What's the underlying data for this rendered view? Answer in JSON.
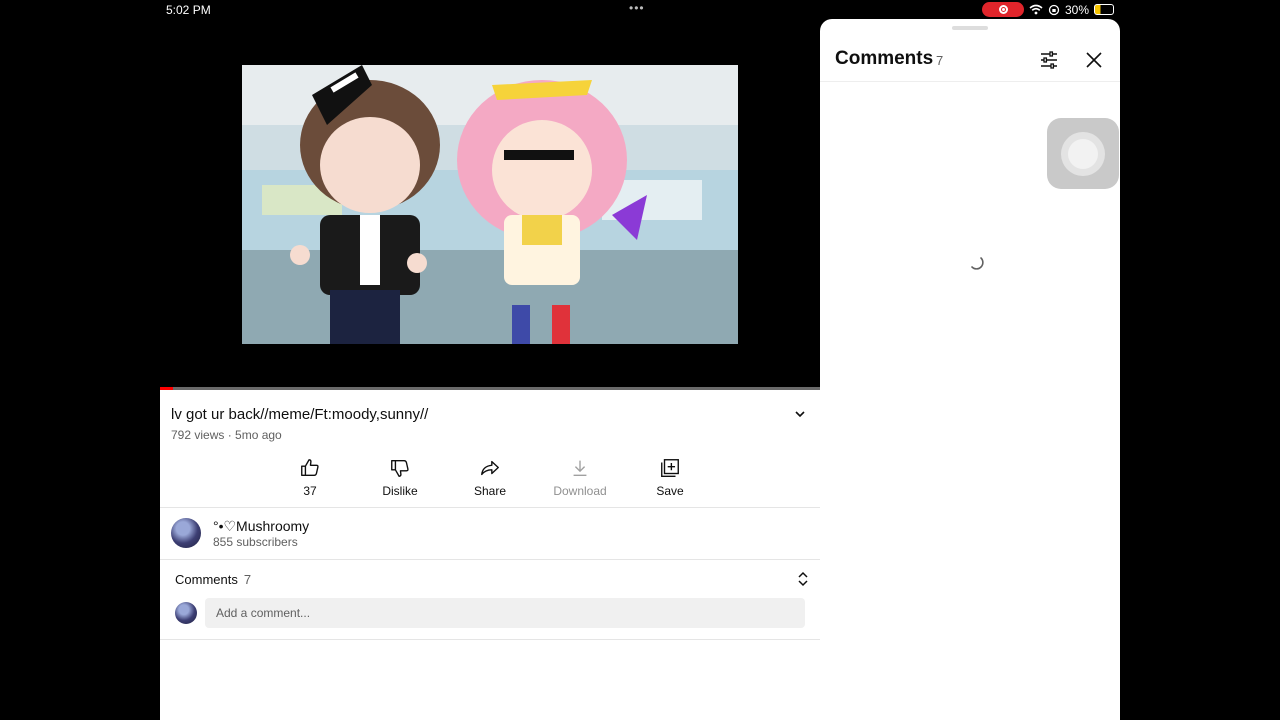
{
  "status_bar": {
    "time": "5:02 PM",
    "battery_percent": "30%",
    "battery_level": 0.3
  },
  "video": {
    "title": "lv got ur back//meme/Ft:moody,sunny//",
    "meta": "792 views · 5mo ago",
    "progress": 0.02
  },
  "actions": {
    "like_count": "37",
    "dislike_label": "Dislike",
    "share_label": "Share",
    "download_label": "Download",
    "save_label": "Save"
  },
  "channel": {
    "name": "°•♡Mushroomy",
    "subscribers": "855 subscribers"
  },
  "comments_section": {
    "label": "Comments",
    "count": "7",
    "add_placeholder": "Add a comment..."
  },
  "comments_panel": {
    "title": "Comments",
    "count": "7"
  },
  "icons": {
    "like": "thumbs-up-icon",
    "dislike": "thumbs-down-icon",
    "share": "share-arrow-icon",
    "download": "download-icon",
    "save": "save-playlist-icon",
    "filter": "sliders-icon",
    "close": "close-icon",
    "expand": "chevron-down-icon",
    "sort": "unfold-icon"
  },
  "colors": {
    "accent_red": "#ff0000",
    "record_red": "#e0252b",
    "text_primary": "#0f0f0f",
    "text_secondary": "#606060"
  }
}
